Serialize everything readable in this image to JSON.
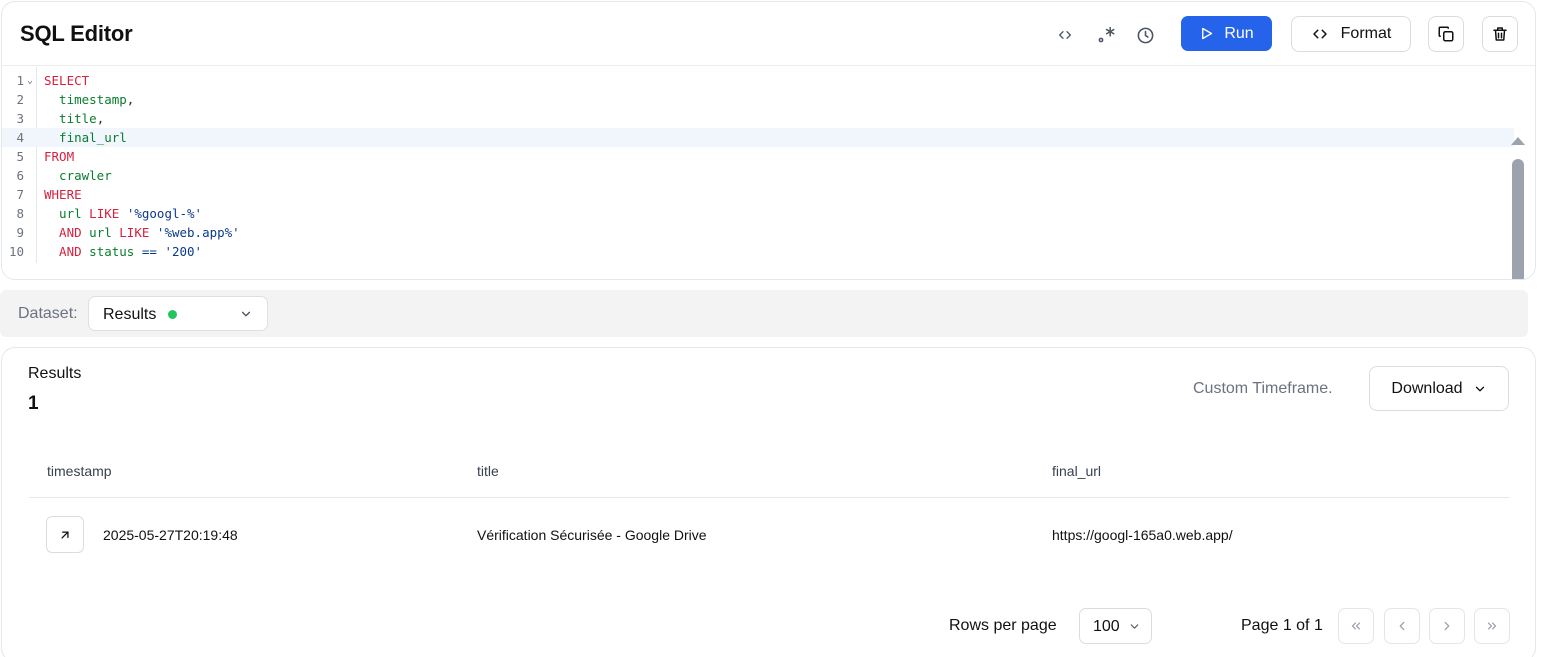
{
  "editor": {
    "title": "SQL Editor",
    "run_label": "Run",
    "format_label": "Format",
    "icons": [
      "code-icon",
      "regex-icon",
      "history-icon",
      "play-icon",
      "copy-icon",
      "trash-icon"
    ]
  },
  "code_lines": [
    {
      "n": "1",
      "tokens": [
        {
          "t": "SELECT",
          "c": "kw"
        }
      ]
    },
    {
      "n": "2",
      "tokens": [
        {
          "t": "  timestamp",
          "c": "id"
        },
        {
          "t": ",",
          "c": "pn"
        }
      ]
    },
    {
      "n": "3",
      "tokens": [
        {
          "t": "  title",
          "c": "id"
        },
        {
          "t": ",",
          "c": "pn"
        }
      ]
    },
    {
      "n": "4",
      "tokens": [
        {
          "t": "  final_url",
          "c": "id"
        }
      ]
    },
    {
      "n": "5",
      "tokens": [
        {
          "t": "FROM",
          "c": "kw"
        }
      ]
    },
    {
      "n": "6",
      "tokens": [
        {
          "t": "  crawler",
          "c": "id"
        }
      ]
    },
    {
      "n": "7",
      "tokens": [
        {
          "t": "WHERE",
          "c": "kw"
        }
      ]
    },
    {
      "n": "8",
      "tokens": [
        {
          "t": "  url",
          "c": "id"
        },
        {
          "t": " ",
          "c": "pn"
        },
        {
          "t": "LIKE",
          "c": "kw"
        },
        {
          "t": " ",
          "c": "pn"
        },
        {
          "t": "'%googl-%'",
          "c": "str"
        }
      ]
    },
    {
      "n": "9",
      "tokens": [
        {
          "t": "  AND",
          "c": "kw"
        },
        {
          "t": " ",
          "c": "pn"
        },
        {
          "t": "url",
          "c": "id"
        },
        {
          "t": " ",
          "c": "pn"
        },
        {
          "t": "LIKE",
          "c": "kw"
        },
        {
          "t": " ",
          "c": "pn"
        },
        {
          "t": "'%web.app%'",
          "c": "str"
        }
      ]
    },
    {
      "n": "10",
      "tokens": [
        {
          "t": "  AND",
          "c": "kw"
        },
        {
          "t": " ",
          "c": "pn"
        },
        {
          "t": "status",
          "c": "id"
        },
        {
          "t": " ",
          "c": "pn"
        },
        {
          "t": "==",
          "c": "op"
        },
        {
          "t": " ",
          "c": "pn"
        },
        {
          "t": "'200'",
          "c": "str"
        }
      ]
    }
  ],
  "active_line": "4",
  "dataset": {
    "label": "Dataset:",
    "value": "Results",
    "status_color": "#22c55e"
  },
  "results": {
    "label": "Results",
    "count": "1",
    "timeframe": "Custom Timeframe.",
    "download_label": "Download",
    "columns": [
      "timestamp",
      "title",
      "final_url"
    ],
    "rows": [
      [
        "2025-05-27T20:19:48",
        "Vérification Sécurisée - Google Drive",
        "https://googl-165a0.web.app/"
      ]
    ]
  },
  "pagination": {
    "rows_per_page_label": "Rows per page",
    "rows_per_page": "100",
    "page_info": "Page 1 of 1"
  },
  "colors": {
    "accent": "#2563eb",
    "keyword": "#d6213f",
    "identifier": "#0a7d2e",
    "string": "#0b3a8c"
  }
}
